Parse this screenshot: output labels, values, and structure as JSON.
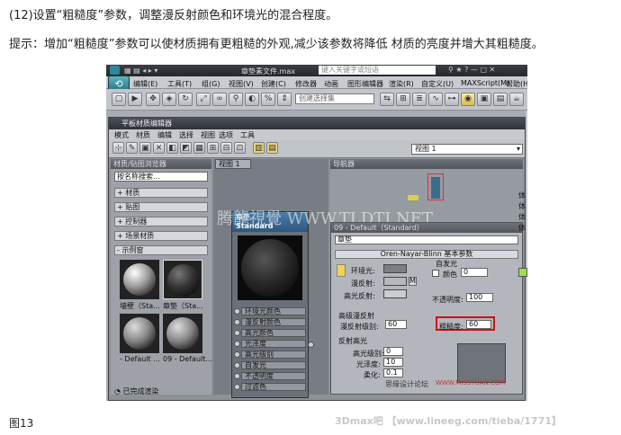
{
  "tutorial": {
    "step": "(12)设置“粗糙度”参数，调整漫反射颜色和环境光的混合程度。",
    "tip": "提示：增加“粗糙度”参数可以使材质拥有更粗糙的外观,减少该参数将降低 材质的亮度并增大其粗糙度。",
    "fig_label": "图13",
    "footer_credit": "3Dmax吧 【www.lineeg.com/tieba/1771】"
  },
  "app": {
    "window_title": "章垫素文件.max",
    "search_placeholder": "键入关键字或短语",
    "menu": [
      "编辑(E)",
      "工具(T)",
      "组(G)",
      "视图(V)",
      "创建(C)",
      "修改器",
      "动画",
      "图形编辑器",
      "渲染(R)",
      "自定义(U)",
      "MAXScript(M)",
      "帮助(H)"
    ],
    "selection_set": "创建选择集",
    "right_panel_labels": [
      "体",
      "体",
      "体",
      "体"
    ]
  },
  "slate": {
    "title": "平板材质编辑器",
    "menu": [
      "模式",
      "材质",
      "编辑",
      "选择",
      "视图",
      "选项",
      "工具"
    ],
    "view_dropdown": "视图 1",
    "browser": {
      "header": "材质/贴图浏览器",
      "search": "按名称搜索...",
      "sections": [
        "+ 材质",
        "+ 贴图",
        "+ 控制器",
        "+ 场景材质",
        "- 示例窗"
      ],
      "samples": [
        "墙壁（Sta...",
        "章垫（Sta...",
        "- Default ...",
        "09 - Default..."
      ]
    },
    "view_tab": "视图 1",
    "nav_header": "导航器",
    "watermark": "腾龍視覺 WWW.TLDTI.NET",
    "node": {
      "name": "章垫",
      "type": "Standard",
      "slots": [
        "环境光颜色",
        "漫反射颜色",
        "高光颜色",
        "光泽度",
        "高光级别",
        "自发光",
        "不透明度",
        "过滤色"
      ]
    },
    "params": {
      "material_title": "09 - Default（Standard）",
      "material_name": "章垫",
      "rollout": "Oren-Nayar-Blinn 基本参数",
      "self_illum_label": "自发光",
      "color_label": "颜色",
      "color_value": "0",
      "ambient_label": "环境光:",
      "diffuse_label": "漫反射:",
      "specular_label": "高光反射:",
      "opacity_label": "不透明度:",
      "opacity_value": "100",
      "adv_diffuse_label": "高级漫反射",
      "diffuse_level_label": "漫反射级别:",
      "diffuse_level_value": "60",
      "roughness_label": "粗糙度:",
      "roughness_value": "60",
      "spec_highlight_label": "反射高光",
      "spec_level_label": "高光级别:",
      "spec_level_value": "0",
      "gloss_label": "光泽度:",
      "gloss_value": "10",
      "soften_label": "柔化:",
      "soften_value": "0.1",
      "m_button": "M"
    },
    "status": "已完成渲染"
  },
  "watermarks": [
    "思缘设计论坛",
    "WWW.MISSYUAN.COM"
  ]
}
